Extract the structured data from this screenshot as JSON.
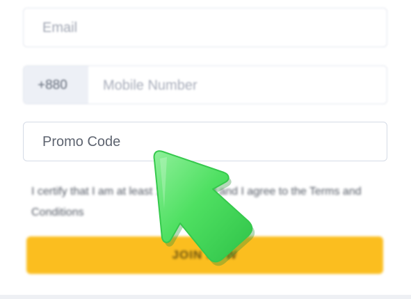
{
  "form": {
    "email": {
      "placeholder": "Email"
    },
    "mobile": {
      "country_code": "+880",
      "placeholder": "Mobile Number"
    },
    "promo": {
      "placeholder": "Promo Code"
    },
    "terms_text": "I certify that I am at least 18 years old and I agree to the Terms and Conditions",
    "join_button": {
      "label": "JOIN NOW",
      "color": "#fbbe1f"
    }
  },
  "overlay": {
    "cursor_icon": "arrow-pointer-icon",
    "cursor_color": "#4fe062"
  }
}
